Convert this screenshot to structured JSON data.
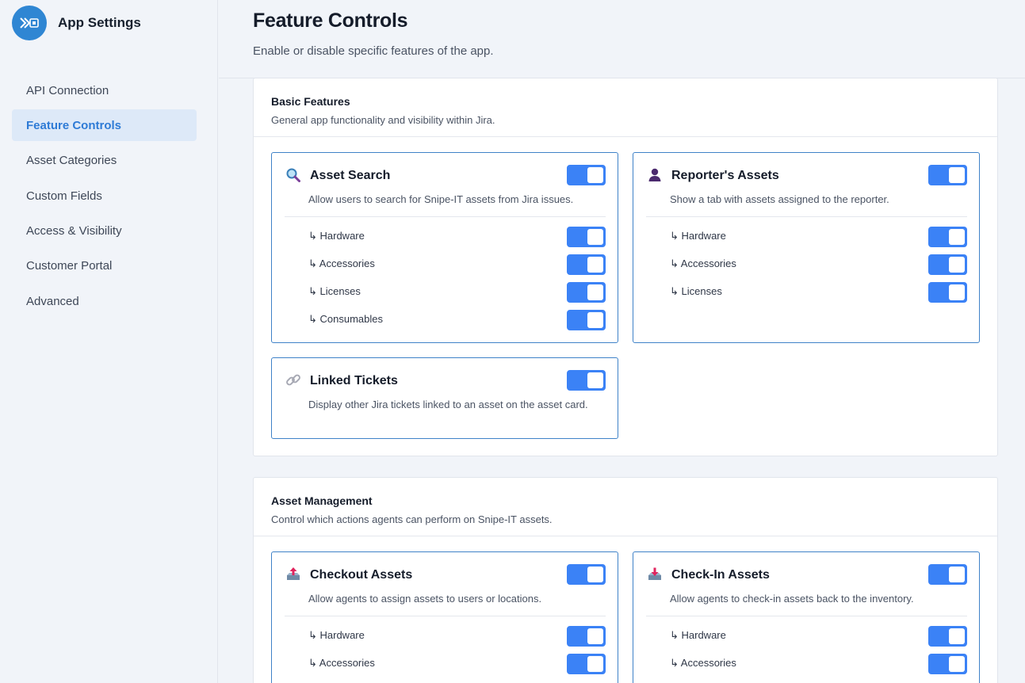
{
  "sidebar": {
    "title": "App Settings",
    "items": [
      {
        "label": "API Connection",
        "active": false
      },
      {
        "label": "Feature Controls",
        "active": true
      },
      {
        "label": "Asset Categories",
        "active": false
      },
      {
        "label": "Custom Fields",
        "active": false
      },
      {
        "label": "Access & Visibility",
        "active": false
      },
      {
        "label": "Customer Portal",
        "active": false
      },
      {
        "label": "Advanced",
        "active": false
      }
    ]
  },
  "header": {
    "title": "Feature Controls",
    "subtitle": "Enable or disable specific features of the app."
  },
  "sections": {
    "basic": {
      "title": "Basic Features",
      "desc": "General app functionality and visibility within Jira.",
      "asset_search": {
        "icon": "magnifier-icon",
        "title": "Asset Search",
        "desc": "Allow users to search for Snipe-IT assets from Jira issues.",
        "enabled": true,
        "subs": [
          {
            "label": "↳ Hardware",
            "enabled": true
          },
          {
            "label": "↳ Accessories",
            "enabled": true
          },
          {
            "label": "↳ Licenses",
            "enabled": true
          },
          {
            "label": "↳ Consumables",
            "enabled": true
          }
        ]
      },
      "reporter_assets": {
        "icon": "user-icon",
        "title": "Reporter's Assets",
        "desc": "Show a tab with assets assigned to the reporter.",
        "enabled": true,
        "subs": [
          {
            "label": "↳ Hardware",
            "enabled": true
          },
          {
            "label": "↳ Accessories",
            "enabled": true
          },
          {
            "label": "↳ Licenses",
            "enabled": true
          }
        ]
      },
      "linked_tickets": {
        "icon": "link-icon",
        "title": "Linked Tickets",
        "desc": "Display other Jira tickets linked to an asset on the asset card.",
        "enabled": true
      }
    },
    "management": {
      "title": "Asset Management",
      "desc": "Control which actions agents can perform on Snipe-IT assets.",
      "checkout": {
        "icon": "outbox-tray-icon",
        "title": "Checkout Assets",
        "desc": "Allow agents to assign assets to users or locations.",
        "enabled": true,
        "subs": [
          {
            "label": "↳ Hardware",
            "enabled": true
          },
          {
            "label": "↳ Accessories",
            "enabled": true
          }
        ]
      },
      "checkin": {
        "icon": "inbox-tray-icon",
        "title": "Check-In Assets",
        "desc": "Allow agents to check-in assets back to the inventory.",
        "enabled": true,
        "subs": [
          {
            "label": "↳ Hardware",
            "enabled": true
          },
          {
            "label": "↳ Accessories",
            "enabled": true
          }
        ]
      }
    }
  },
  "colors": {
    "accent": "#3b82f6",
    "card_border": "#3f82c8",
    "active_nav_bg": "#dde9f8",
    "active_nav_text": "#2e7bd6"
  }
}
